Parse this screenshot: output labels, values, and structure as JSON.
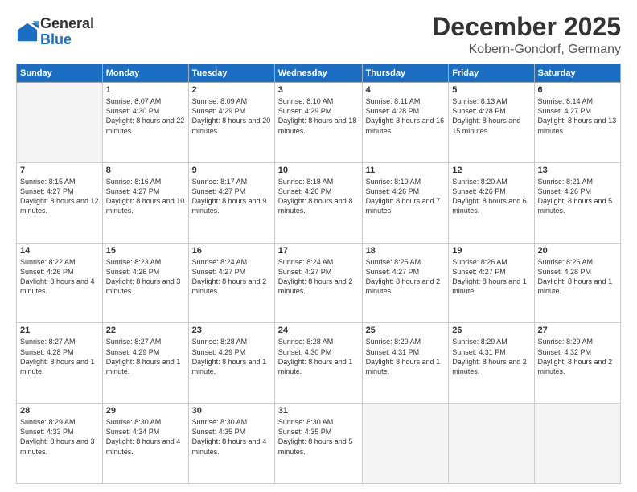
{
  "logo": {
    "general": "General",
    "blue": "Blue"
  },
  "header": {
    "month": "December 2025",
    "location": "Kobern-Gondorf, Germany"
  },
  "weekdays": [
    "Sunday",
    "Monday",
    "Tuesday",
    "Wednesday",
    "Thursday",
    "Friday",
    "Saturday"
  ],
  "weeks": [
    [
      {
        "day": "",
        "sunrise": "",
        "sunset": "",
        "daylight": ""
      },
      {
        "day": "1",
        "sunrise": "Sunrise: 8:07 AM",
        "sunset": "Sunset: 4:30 PM",
        "daylight": "Daylight: 8 hours and 22 minutes."
      },
      {
        "day": "2",
        "sunrise": "Sunrise: 8:09 AM",
        "sunset": "Sunset: 4:29 PM",
        "daylight": "Daylight: 8 hours and 20 minutes."
      },
      {
        "day": "3",
        "sunrise": "Sunrise: 8:10 AM",
        "sunset": "Sunset: 4:29 PM",
        "daylight": "Daylight: 8 hours and 18 minutes."
      },
      {
        "day": "4",
        "sunrise": "Sunrise: 8:11 AM",
        "sunset": "Sunset: 4:28 PM",
        "daylight": "Daylight: 8 hours and 16 minutes."
      },
      {
        "day": "5",
        "sunrise": "Sunrise: 8:13 AM",
        "sunset": "Sunset: 4:28 PM",
        "daylight": "Daylight: 8 hours and 15 minutes."
      },
      {
        "day": "6",
        "sunrise": "Sunrise: 8:14 AM",
        "sunset": "Sunset: 4:27 PM",
        "daylight": "Daylight: 8 hours and 13 minutes."
      }
    ],
    [
      {
        "day": "7",
        "sunrise": "Sunrise: 8:15 AM",
        "sunset": "Sunset: 4:27 PM",
        "daylight": "Daylight: 8 hours and 12 minutes."
      },
      {
        "day": "8",
        "sunrise": "Sunrise: 8:16 AM",
        "sunset": "Sunset: 4:27 PM",
        "daylight": "Daylight: 8 hours and 10 minutes."
      },
      {
        "day": "9",
        "sunrise": "Sunrise: 8:17 AM",
        "sunset": "Sunset: 4:27 PM",
        "daylight": "Daylight: 8 hours and 9 minutes."
      },
      {
        "day": "10",
        "sunrise": "Sunrise: 8:18 AM",
        "sunset": "Sunset: 4:26 PM",
        "daylight": "Daylight: 8 hours and 8 minutes."
      },
      {
        "day": "11",
        "sunrise": "Sunrise: 8:19 AM",
        "sunset": "Sunset: 4:26 PM",
        "daylight": "Daylight: 8 hours and 7 minutes."
      },
      {
        "day": "12",
        "sunrise": "Sunrise: 8:20 AM",
        "sunset": "Sunset: 4:26 PM",
        "daylight": "Daylight: 8 hours and 6 minutes."
      },
      {
        "day": "13",
        "sunrise": "Sunrise: 8:21 AM",
        "sunset": "Sunset: 4:26 PM",
        "daylight": "Daylight: 8 hours and 5 minutes."
      }
    ],
    [
      {
        "day": "14",
        "sunrise": "Sunrise: 8:22 AM",
        "sunset": "Sunset: 4:26 PM",
        "daylight": "Daylight: 8 hours and 4 minutes."
      },
      {
        "day": "15",
        "sunrise": "Sunrise: 8:23 AM",
        "sunset": "Sunset: 4:26 PM",
        "daylight": "Daylight: 8 hours and 3 minutes."
      },
      {
        "day": "16",
        "sunrise": "Sunrise: 8:24 AM",
        "sunset": "Sunset: 4:27 PM",
        "daylight": "Daylight: 8 hours and 2 minutes."
      },
      {
        "day": "17",
        "sunrise": "Sunrise: 8:24 AM",
        "sunset": "Sunset: 4:27 PM",
        "daylight": "Daylight: 8 hours and 2 minutes."
      },
      {
        "day": "18",
        "sunrise": "Sunrise: 8:25 AM",
        "sunset": "Sunset: 4:27 PM",
        "daylight": "Daylight: 8 hours and 2 minutes."
      },
      {
        "day": "19",
        "sunrise": "Sunrise: 8:26 AM",
        "sunset": "Sunset: 4:27 PM",
        "daylight": "Daylight: 8 hours and 1 minute."
      },
      {
        "day": "20",
        "sunrise": "Sunrise: 8:26 AM",
        "sunset": "Sunset: 4:28 PM",
        "daylight": "Daylight: 8 hours and 1 minute."
      }
    ],
    [
      {
        "day": "21",
        "sunrise": "Sunrise: 8:27 AM",
        "sunset": "Sunset: 4:28 PM",
        "daylight": "Daylight: 8 hours and 1 minute."
      },
      {
        "day": "22",
        "sunrise": "Sunrise: 8:27 AM",
        "sunset": "Sunset: 4:29 PM",
        "daylight": "Daylight: 8 hours and 1 minute."
      },
      {
        "day": "23",
        "sunrise": "Sunrise: 8:28 AM",
        "sunset": "Sunset: 4:29 PM",
        "daylight": "Daylight: 8 hours and 1 minute."
      },
      {
        "day": "24",
        "sunrise": "Sunrise: 8:28 AM",
        "sunset": "Sunset: 4:30 PM",
        "daylight": "Daylight: 8 hours and 1 minute."
      },
      {
        "day": "25",
        "sunrise": "Sunrise: 8:29 AM",
        "sunset": "Sunset: 4:31 PM",
        "daylight": "Daylight: 8 hours and 1 minute."
      },
      {
        "day": "26",
        "sunrise": "Sunrise: 8:29 AM",
        "sunset": "Sunset: 4:31 PM",
        "daylight": "Daylight: 8 hours and 2 minutes."
      },
      {
        "day": "27",
        "sunrise": "Sunrise: 8:29 AM",
        "sunset": "Sunset: 4:32 PM",
        "daylight": "Daylight: 8 hours and 2 minutes."
      }
    ],
    [
      {
        "day": "28",
        "sunrise": "Sunrise: 8:29 AM",
        "sunset": "Sunset: 4:33 PM",
        "daylight": "Daylight: 8 hours and 3 minutes."
      },
      {
        "day": "29",
        "sunrise": "Sunrise: 8:30 AM",
        "sunset": "Sunset: 4:34 PM",
        "daylight": "Daylight: 8 hours and 4 minutes."
      },
      {
        "day": "30",
        "sunrise": "Sunrise: 8:30 AM",
        "sunset": "Sunset: 4:35 PM",
        "daylight": "Daylight: 8 hours and 4 minutes."
      },
      {
        "day": "31",
        "sunrise": "Sunrise: 8:30 AM",
        "sunset": "Sunset: 4:35 PM",
        "daylight": "Daylight: 8 hours and 5 minutes."
      },
      {
        "day": "",
        "sunrise": "",
        "sunset": "",
        "daylight": ""
      },
      {
        "day": "",
        "sunrise": "",
        "sunset": "",
        "daylight": ""
      },
      {
        "day": "",
        "sunrise": "",
        "sunset": "",
        "daylight": ""
      }
    ]
  ]
}
